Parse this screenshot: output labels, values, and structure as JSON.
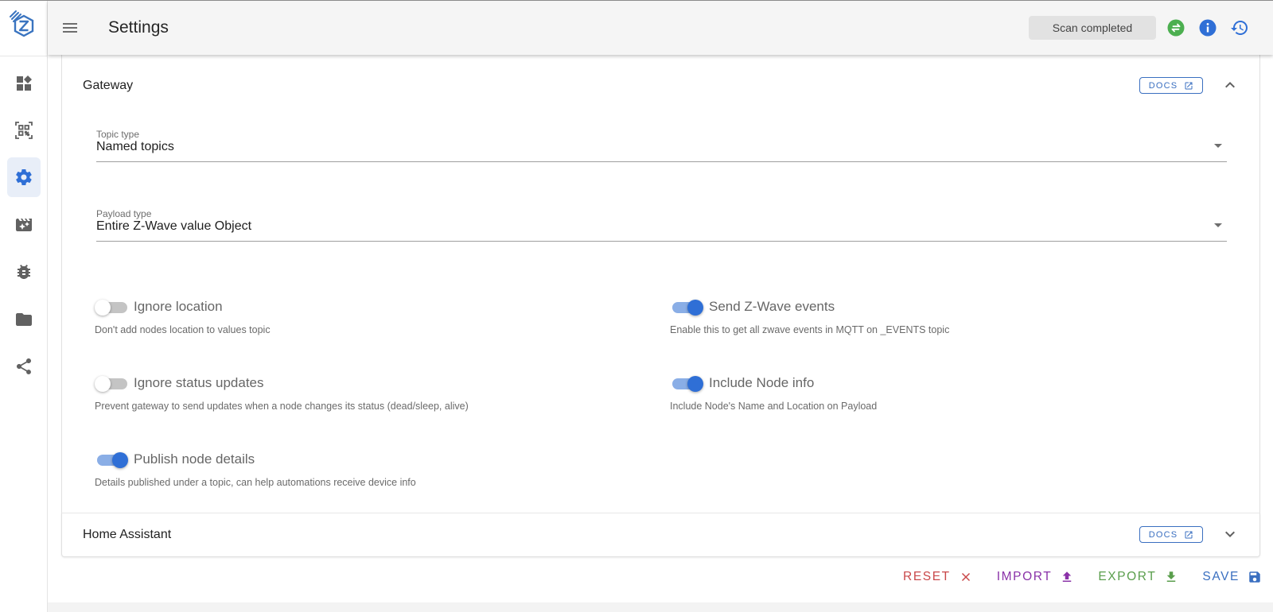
{
  "app": {
    "logo": "zwave-js-ui-logo"
  },
  "sidebar": {
    "items": [
      {
        "name": "dashboard",
        "icon": "dashboard-icon",
        "active": false
      },
      {
        "name": "smart-start",
        "icon": "qr-scan-icon",
        "active": false
      },
      {
        "name": "settings",
        "icon": "gear-icon",
        "active": true
      },
      {
        "name": "scenes",
        "icon": "movie-filter-icon",
        "active": false
      },
      {
        "name": "debug",
        "icon": "bug-icon",
        "active": false
      },
      {
        "name": "store",
        "icon": "folder-icon",
        "active": false
      },
      {
        "name": "network-graph",
        "icon": "share-icon",
        "active": false
      }
    ]
  },
  "header": {
    "menu_icon": "hamburger-menu-icon",
    "title": "Settings",
    "status": "Scan completed",
    "icons": [
      "swap-arrows-icon",
      "info-icon",
      "history-icon"
    ],
    "colors": {
      "swap": "#4caf50",
      "info": "#2f6fd6",
      "history": "#2f6fd6"
    }
  },
  "gateway": {
    "title": "Gateway",
    "docs_label": "DOCS",
    "expanded": true,
    "topic_type": {
      "label": "Topic type",
      "value": "Named topics"
    },
    "payload_type": {
      "label": "Payload type",
      "value": "Entire Z-Wave value Object"
    },
    "toggles": [
      {
        "label": "Ignore location",
        "hint": "Don't add nodes location to values topic",
        "on": false
      },
      {
        "label": "Send Z-Wave events",
        "hint": "Enable this to get all zwave events in MQTT on _EVENTS topic",
        "on": true
      },
      {
        "label": "Ignore status updates",
        "hint": "Prevent gateway to send updates when a node changes its status (dead/sleep, alive)",
        "on": false
      },
      {
        "label": "Include Node info",
        "hint": "Include Node's Name and Location on Payload",
        "on": true
      },
      {
        "label": "Publish node details",
        "hint": "Details published under a topic, can help automations receive device info",
        "on": true
      }
    ]
  },
  "home_assistant": {
    "title": "Home Assistant",
    "docs_label": "DOCS",
    "expanded": false
  },
  "actions": {
    "reset": "RESET",
    "import": "IMPORT",
    "export": "EXPORT",
    "save": "SAVE",
    "colors": {
      "reset": "#c9484a",
      "import": "#8a32a8",
      "export": "#5a9e4c",
      "save": "#3a6fc0"
    }
  }
}
